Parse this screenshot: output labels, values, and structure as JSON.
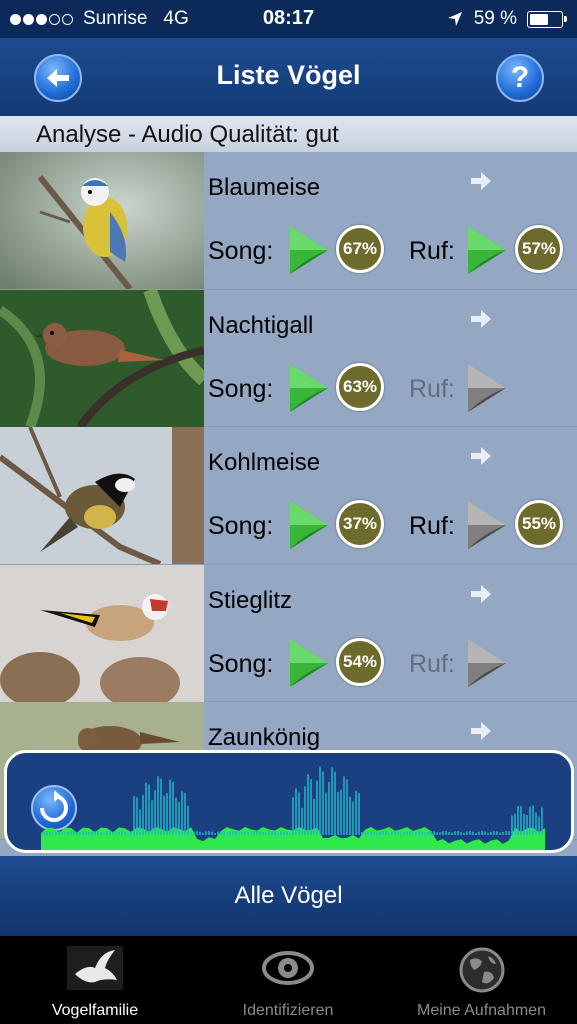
{
  "status_bar": {
    "carrier": "Sunrise",
    "network": "4G",
    "time": "08:17",
    "battery": "59 %",
    "battery_level": 0.59,
    "signal_bars_filled": 3,
    "signal_bars_total": 5
  },
  "navbar": {
    "title": "Liste Vögel",
    "help_label": "?"
  },
  "analysis": {
    "text": "Analyse - Audio Qualität: gut"
  },
  "labels": {
    "song": "Song:",
    "ruf": "Ruf:"
  },
  "birds": [
    {
      "name": "Blaumeise",
      "song_available": true,
      "song_pct": "67%",
      "ruf_available": true,
      "ruf_pct": "57%"
    },
    {
      "name": "Nachtigall",
      "song_available": true,
      "song_pct": "63%",
      "ruf_available": false,
      "ruf_pct": ""
    },
    {
      "name": "Kohlmeise",
      "song_available": true,
      "song_pct": "37%",
      "ruf_available": false,
      "ruf_pct": "55%"
    },
    {
      "name": "Stieglitz",
      "song_available": true,
      "song_pct": "54%",
      "ruf_available": false,
      "ruf_pct": ""
    },
    {
      "name": "Zaunkönig",
      "song_available": true,
      "song_pct": "",
      "ruf_available": false,
      "ruf_pct": ""
    }
  ],
  "all_birds_button": "Alle Vögel",
  "tabs": [
    {
      "label": "Vogelfamilie",
      "icon": "dove-icon",
      "selected": true
    },
    {
      "label": "Identifizieren",
      "icon": "eye-icon",
      "selected": false
    },
    {
      "label": "Meine Aufnahmen",
      "icon": "globe-icon",
      "selected": false
    }
  ],
  "colors": {
    "nav_blue": "#1d4b8f",
    "list_bg": "#94a8c3",
    "play_green": "#3cb03c",
    "play_gray": "#8a8a8a",
    "pct_olive": "#6c6b2c",
    "wave_green": "#2fe84a",
    "wave_cyan": "#23b7c9"
  }
}
